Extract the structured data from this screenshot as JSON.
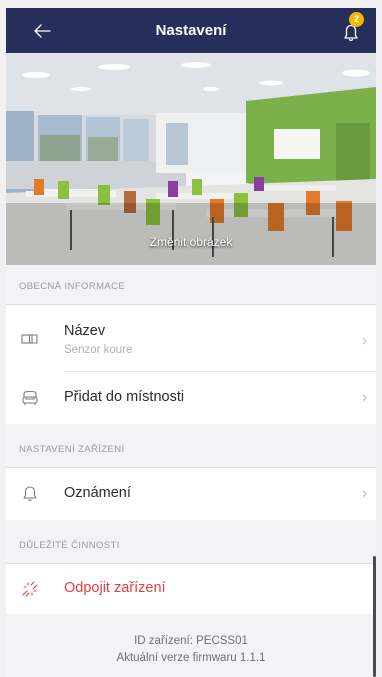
{
  "header": {
    "title": "Nastavení",
    "notification_count": "2",
    "back_icon": "arrow-left-icon",
    "bell_icon": "bell-icon"
  },
  "hero": {
    "caption": "Změnit obrázek"
  },
  "sections": {
    "general": "OBECNÁ INFORMACE",
    "device_settings": "NASTAVENÍ ZAŘÍZENÍ",
    "important_actions": "DŮLEŽITÉ ČINNOSTI"
  },
  "rows": {
    "name": {
      "label": "Název",
      "value": "Senzor koure",
      "icon": "tag-icon"
    },
    "room": {
      "label": "Přidat do místnosti",
      "icon": "sofa-icon"
    },
    "notifications": {
      "label": "Oznámení",
      "icon": "bell-icon"
    },
    "disconnect": {
      "label": "Odpojit zařízení",
      "icon": "broken-link-icon"
    }
  },
  "footer": {
    "device_id": "ID zařízení: PECSS01",
    "firmware": "Aktuální verze firmwaru 1.1.1"
  },
  "colors": {
    "header_bg": "#262f5a",
    "badge": "#f2b800",
    "danger": "#e2403f"
  }
}
